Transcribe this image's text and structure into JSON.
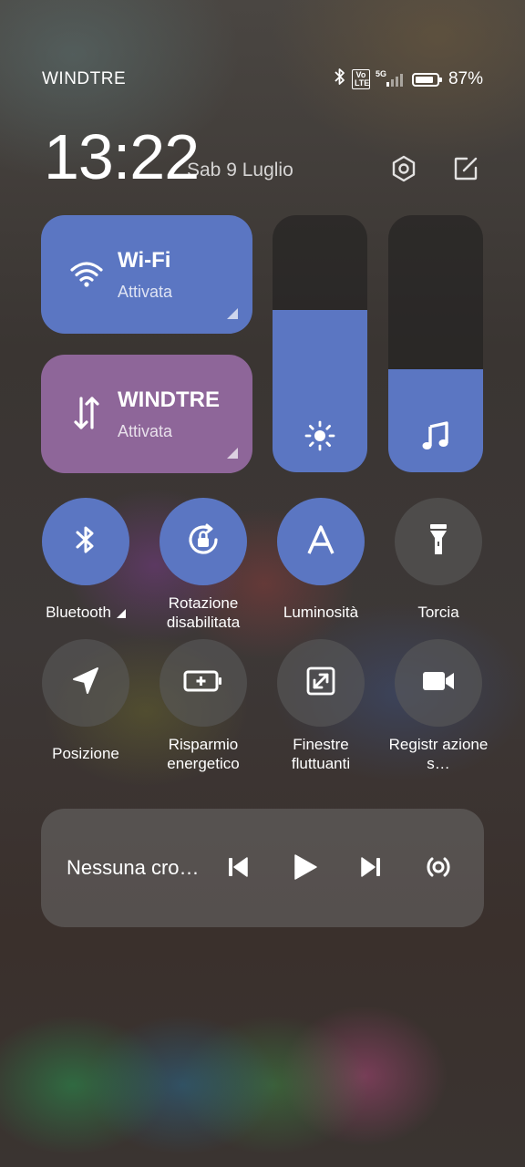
{
  "status_bar": {
    "carrier": "WINDTRE",
    "volte_badge": "Vo LTE",
    "network": "5G",
    "battery_percent": "87%",
    "battery_level": 0.87,
    "icons": [
      "bluetooth-icon",
      "volte-icon",
      "signal-icon",
      "battery-icon"
    ]
  },
  "header": {
    "time": "13:22",
    "date": "Sab 9 Luglio",
    "icons": [
      "settings-icon",
      "edit-icon"
    ]
  },
  "tiles": {
    "wifi": {
      "title": "Wi-Fi",
      "status": "Attivata",
      "icon": "wifi-icon"
    },
    "mobile_data": {
      "title": "WINDTRE",
      "status": "Attivata",
      "icon": "data-arrows-icon"
    }
  },
  "sliders": {
    "brightness": {
      "level": 0.63,
      "icon": "sun-icon"
    },
    "volume": {
      "level": 0.4,
      "icon": "music-note-icon"
    }
  },
  "toggles": [
    {
      "label": "Bluetooth",
      "state": "on",
      "icon": "bluetooth-icon"
    },
    {
      "label": "Rotazione disabilitata",
      "state": "on",
      "icon": "rotation-lock-icon"
    },
    {
      "label": "Luminosità",
      "state": "on",
      "icon": "auto-brightness-icon"
    },
    {
      "label": "Torcia",
      "state": "off",
      "icon": "flashlight-icon"
    },
    {
      "label": "Posizione",
      "state": "off",
      "icon": "location-icon"
    },
    {
      "label": "Risparmio energetico",
      "state": "off",
      "icon": "battery-saver-icon"
    },
    {
      "label": "Finestre fluttuanti",
      "state": "off",
      "icon": "floating-window-icon"
    },
    {
      "label": "Registr azione s…",
      "state": "off",
      "icon": "video-camera-icon"
    }
  ],
  "media": {
    "title": "Nessuna cro…",
    "icons": [
      "previous-icon",
      "play-icon",
      "next-icon",
      "cast-icon"
    ]
  },
  "colors": {
    "accent_blue": "#5b76c2",
    "accent_purple": "#8e6699"
  }
}
